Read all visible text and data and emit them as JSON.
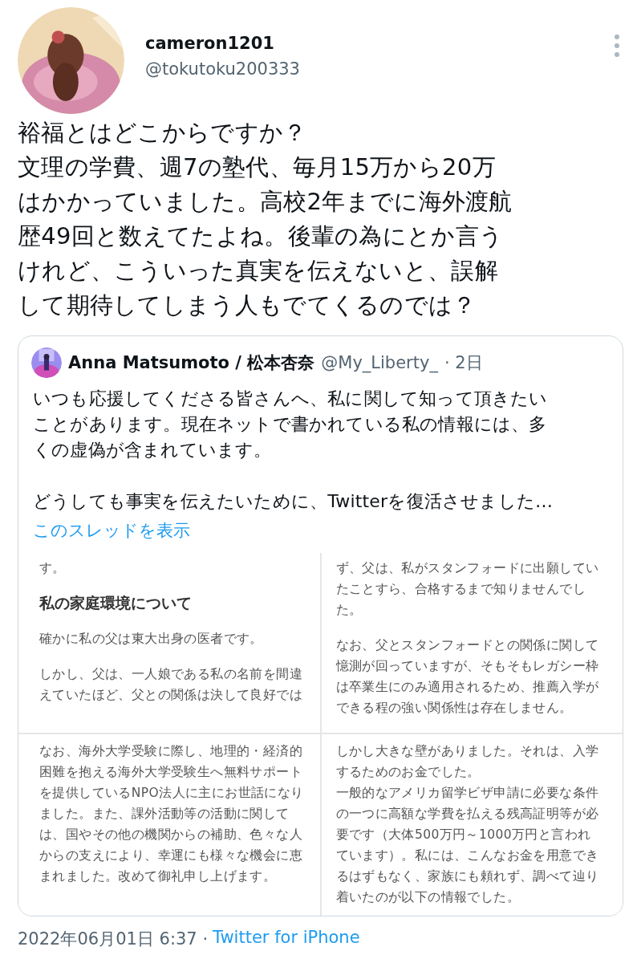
{
  "author": {
    "name": "cameron1201",
    "handle": "@tokutoku200333",
    "avatar": {
      "kind": "picture"
    }
  },
  "tweet_text": [
    "裕福とはどこからですか？",
    "文理の学費、週7の塾代、毎月15万から20万",
    "はかかっていました。高校2年までに海外渡航",
    "歴49回と数えてたよね。後輩の為にとか言う",
    "けれど、こういった真実を伝えないと、誤解",
    "して期待してしまう人もでてくるのでは？"
  ],
  "quoted_tweet": {
    "name": "Anna Matsumoto / 松本杏奈",
    "handle": "@My_Liberty_",
    "time": "· 2日",
    "avatar": {
      "kind": "picture"
    },
    "text": [
      [
        "いつも応援してくださる皆さんへ、私に関して知って頂きたい",
        "ことがあります。現在ネットで書かれている私の情報には、多",
        "くの虚偽が含まれています。"
      ],
      [
        "どうしても事実を伝えたいために、Twitterを復活させました…"
      ]
    ],
    "show_thread": "このスレッドを表示",
    "images": [
      {
        "blocks": [
          {
            "kind": "paragraph",
            "lines": [
              "す。"
            ]
          },
          {
            "kind": "heading",
            "lines": [
              "私の家庭環境について"
            ]
          },
          {
            "kind": "paragraph",
            "lines": [
              "確かに私の父は東大出身の医者です。"
            ]
          },
          {
            "kind": "paragraph",
            "lines": [
              "しかし、父は、一人娘である私の名前を間違",
              "えていたほど、父との関係は決して良好では"
            ]
          }
        ]
      },
      {
        "blocks": [
          {
            "kind": "paragraph",
            "lines": [
              "ず、父は、私がスタンフォードに出願してい",
              "たことすら、合格するまで知りませんでし",
              "た。"
            ]
          },
          {
            "kind": "paragraph",
            "lines": [
              "なお、父とスタンフォードとの関係に関して",
              "憶測が回っていますが、そもそもレガシー枠",
              "は卒業生にのみ適用されるため、推薦入学が",
              "できる程の強い関係性は存在しません。"
            ]
          }
        ]
      },
      {
        "blocks": [
          {
            "kind": "paragraph",
            "lines": [
              "なお、海外大学受験に際し、地理的・経済的",
              "困難を抱える海外大学受験生へ無料サポート",
              "を提供しているNPO法人に主にお世話になり",
              "ました。また、課外活動等の活動に関して",
              "は、国やその他の機関からの補助、色々な人",
              "からの支えにより、幸運にも様々な機会に恵",
              "まれました。改めて御礼申し上げます。"
            ]
          }
        ]
      },
      {
        "blocks": [
          {
            "kind": "paragraph",
            "lines": [
              "しかし大きな壁がありました。それは、入学",
              "するためのお金でした。",
              "一般的なアメリカ留学ビザ申請に必要な条件",
              "の一つに高額な学費を払える残高証明等が必",
              "要です（大体500万円～1000万円と言われ",
              "ています）。私には、こんなお金を用意でき",
              "るはずもなく、家族にも頼れず、調べて辿り",
              "着いたのが以下の情報でした。"
            ]
          }
        ]
      }
    ]
  },
  "timestamp": "2022年06月01日 6:37 ·",
  "source": "Twitter for iPhone"
}
